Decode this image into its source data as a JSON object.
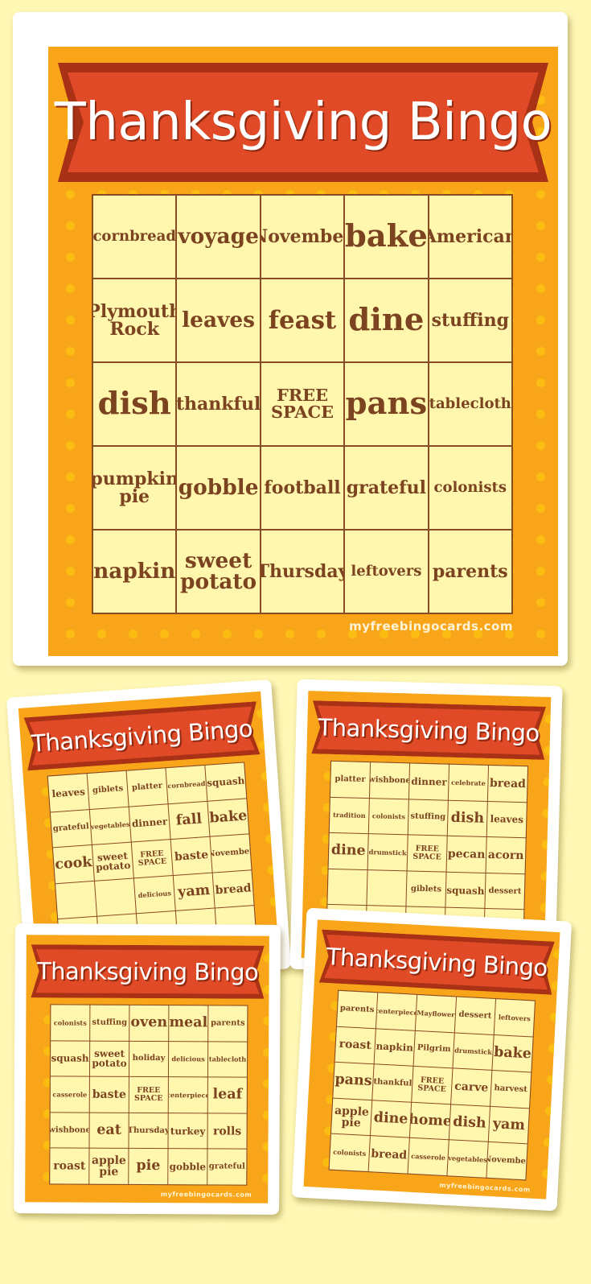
{
  "title": "Thanksgiving Bingo",
  "site": "myfreebingocards.com",
  "colors": {
    "background": "#fff8b5",
    "board": "#f9a51a",
    "polka_dot": "#fcbd12",
    "banner": "#e04a26",
    "banner_border": "#a93116",
    "cell": "#fff7ae",
    "cell_text": "#7c4320",
    "grid_line": "#8a4a22"
  },
  "main_card": {
    "cells": [
      "cornbread",
      "voyage",
      "November",
      "bake",
      "American",
      "Plymouth Rock",
      "leaves",
      "feast",
      "dine",
      "stuffing",
      "dish",
      "thankful",
      "FREE SPACE",
      "pans",
      "tablecloth",
      "pumpkin pie",
      "gobble",
      "football",
      "grateful",
      "colonists",
      "napkin",
      "sweet potato",
      "Thursday",
      "leftovers",
      "parents"
    ]
  },
  "preview_cards": [
    {
      "cells": [
        "leaves",
        "giblets",
        "platter",
        "cornbread",
        "squash",
        "grateful",
        "vegetables",
        "dinner",
        "fall",
        "bake",
        "cook",
        "sweet potato",
        "FREE SPACE",
        "baste",
        "November",
        "",
        "",
        "delicious",
        "yam",
        "bread",
        "",
        "",
        "",
        "",
        ""
      ]
    },
    {
      "cells": [
        "platter",
        "wishbone",
        "dinner",
        "celebrate",
        "bread",
        "tradition",
        "colonists",
        "stuffing",
        "dish",
        "leaves",
        "dine",
        "drumstick",
        "FREE SPACE",
        "pecan",
        "acorn",
        "",
        "",
        "giblets",
        "squash",
        "dessert",
        "",
        "",
        "",
        "",
        ""
      ]
    },
    {
      "cells": [
        "colonists",
        "stuffing",
        "oven",
        "meal",
        "parents",
        "squash",
        "sweet potato",
        "holiday",
        "delicious",
        "tablecloth",
        "casserole",
        "baste",
        "FREE SPACE",
        "centerpiece",
        "leaf",
        "wishbone",
        "eat",
        "Thursday",
        "turkey",
        "rolls",
        "roast",
        "apple pie",
        "pie",
        "gobble",
        "grateful"
      ]
    },
    {
      "cells": [
        "parents",
        "centerpiece",
        "Mayflower",
        "dessert",
        "leftovers",
        "roast",
        "napkin",
        "Pilgrim",
        "drumstick",
        "bake",
        "pans",
        "thankful",
        "FREE SPACE",
        "carve",
        "harvest",
        "apple pie",
        "dine",
        "home",
        "dish",
        "yam",
        "colonists",
        "bread",
        "casserole",
        "vegetables",
        "November"
      ]
    }
  ]
}
